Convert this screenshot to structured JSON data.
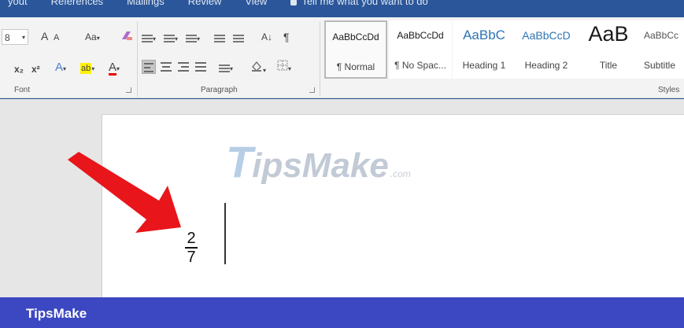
{
  "top_tabs": [
    "yout",
    "References",
    "Mailings",
    "Review",
    "View"
  ],
  "tell_me": "Tell me what you want to do",
  "font_group": {
    "label": "Font",
    "size_value": "8",
    "grow_font": "A",
    "shrink_font": "A",
    "change_case": "Aa",
    "subscript": "x₂",
    "superscript": "x²",
    "text_effects": "A",
    "highlight": "ab",
    "font_color": "A"
  },
  "paragraph_group": {
    "label": "Paragraph",
    "sort": "A↓",
    "pilcrow": "¶"
  },
  "styles_group": {
    "label": "Styles",
    "items": [
      {
        "sample": "AaBbCcDd",
        "name": "¶ Normal"
      },
      {
        "sample": "AaBbCcDd",
        "name": "¶ No Spac..."
      },
      {
        "sample": "AaBbC",
        "name": "Heading 1"
      },
      {
        "sample": "AaBbCcD",
        "name": "Heading 2"
      },
      {
        "sample": "AaB",
        "name": "Title"
      },
      {
        "sample": "AaBbCc",
        "name": "Subtitle"
      }
    ]
  },
  "watermark": {
    "t": "T",
    "rest": "ipsMake",
    "com": ".com"
  },
  "document": {
    "numerator": "2",
    "denominator": "7"
  },
  "brand": "TipsMake",
  "colors": {
    "title_bar": "#2b579a",
    "brand_bar": "#3c47c2",
    "arrow": "#e8151b",
    "ribbon_bg": "#f3f3f3",
    "heading_blue": "#2e74b5"
  },
  "icons": {
    "arrow": "red-arrow-pointer",
    "bullets": "bullets-icon",
    "numbering": "numbering-icon",
    "multilevel": "multilevel-list-icon",
    "indent_decrease": "decrease-indent-icon",
    "indent_increase": "increase-indent-icon",
    "shading": "shading-icon",
    "borders": "borders-icon"
  }
}
